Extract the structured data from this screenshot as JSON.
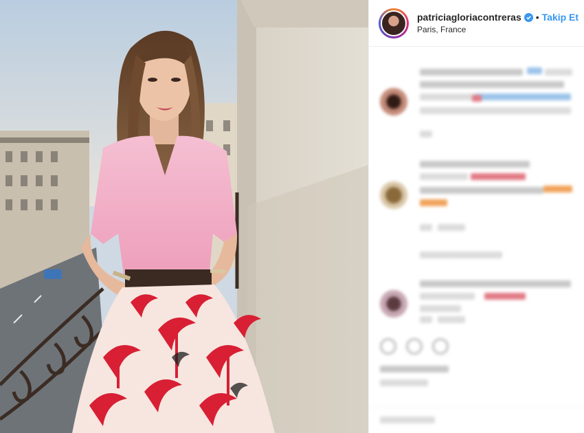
{
  "post": {
    "username": "patriciagloriacontreras",
    "separator": "•",
    "follow_label": "Takip Et",
    "location": "Paris, France",
    "verified": true
  },
  "icons": {
    "verified": "verified-badge-icon",
    "like": "heart-icon",
    "comment": "comment-icon",
    "share": "share-icon"
  },
  "colors": {
    "follow": "#3897f0",
    "verified": "#3897f0",
    "sweater": "#f2b3c9",
    "skirt_print": "#d81f34"
  }
}
